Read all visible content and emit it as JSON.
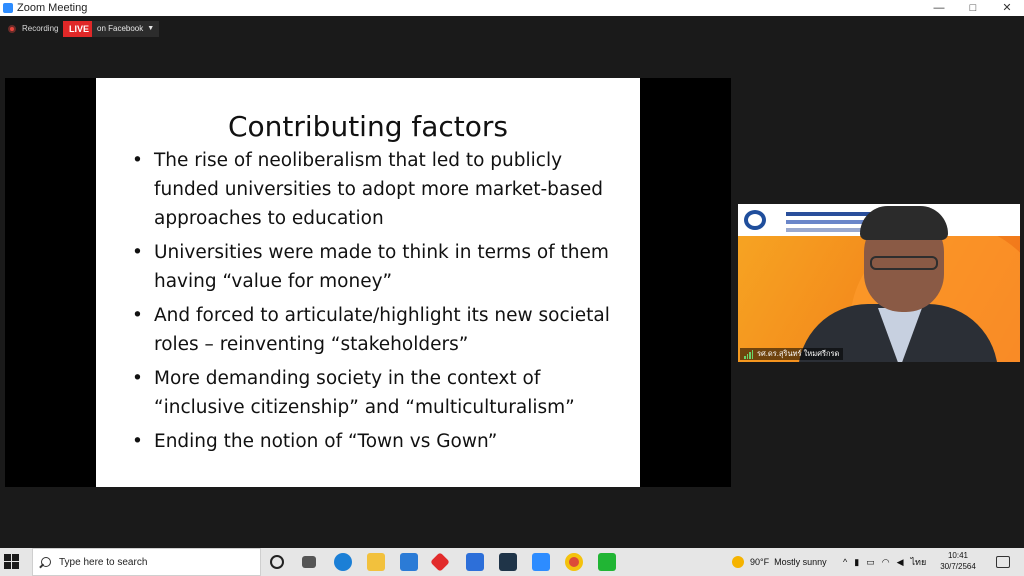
{
  "window": {
    "title": "Zoom Meeting",
    "controls": [
      "—",
      "□",
      "✕"
    ]
  },
  "topbar": {
    "recording_label": "Recording",
    "live_label": "LIVE",
    "stream_target": "on Facebook"
  },
  "slide": {
    "title": "Contributing factors",
    "bullets": [
      "The rise of neoliberalism that led to publicly funded universities to adopt more market-based approaches to education",
      "Universities were made to think in terms of them having “value for money”",
      "And forced to articulate/highlight its new societal roles – reinventing “stakeholders”",
      "More demanding society in the context of “inclusive citizenship” and “multiculturalism”",
      "Ending the notion of “Town vs Gown”"
    ]
  },
  "video": {
    "participant_name": "รศ.ดร.สุรินทร์ ใหมศรีกรด",
    "banner_title": "สัมมนาวิชาการ",
    "banner_sub": "Engagement Thailand (EnT)"
  },
  "taskbar": {
    "search_placeholder": "Type here to search",
    "weather_temp": "90°F",
    "weather_desc": "Mostly sunny",
    "language": "ไทย",
    "time": "10:41",
    "date": "30/7/2564"
  },
  "colors": {
    "live": "#e02828",
    "zoom_blue": "#2d8cff",
    "video_orange": "#f48b1c"
  }
}
